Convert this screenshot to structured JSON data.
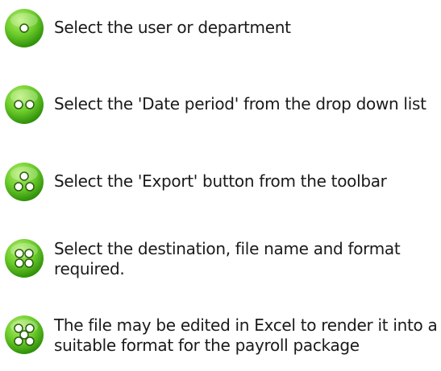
{
  "steps": [
    {
      "dots": 1,
      "text": "Select the user or department"
    },
    {
      "dots": 2,
      "text": "Select the 'Date period' from the drop down list"
    },
    {
      "dots": 3,
      "text": "Select the 'Export' button from the toolbar"
    },
    {
      "dots": 4,
      "text": "Select the destination, file name and format required."
    },
    {
      "dots": 5,
      "text": "The file may be edited in Excel to render it into a suitable format for the payroll package"
    }
  ],
  "colors": {
    "bullet_light": "#8fe04a",
    "bullet_dark": "#2f8f0a",
    "dot": "#ffffff",
    "dot_stroke": "#2a5e10"
  }
}
